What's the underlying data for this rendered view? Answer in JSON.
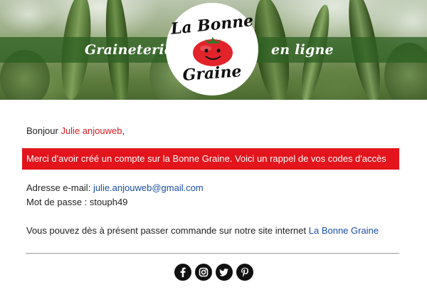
{
  "banner": {
    "left_text": "Graineterie",
    "right_text": "en ligne",
    "logo_top": "La Bonne",
    "logo_bottom": "Graine",
    "band_color": "#2e6022"
  },
  "message": {
    "greeting_prefix": "Bonjour",
    "user_name": "Julie anjouweb",
    "greeting_suffix": ",",
    "alert_text": "Merci d'avoir créé un compte sur la Bonne Graine. Voici un rappel de vos codes d'accès",
    "email_label": "Adresse e-mail:",
    "email_value": "julie.anjouweb@gmail.com",
    "password_label": "Mot de passe :",
    "password_value": "stouph49",
    "order_text": "Vous pouvez dès à présent passer commande sur notre site internet",
    "site_link": "La Bonne Graine"
  },
  "colors": {
    "accent_red": "#e3141c",
    "link_blue": "#1a4fa8"
  },
  "social": [
    {
      "icon": "facebook-icon"
    },
    {
      "icon": "instagram-icon"
    },
    {
      "icon": "twitter-icon"
    },
    {
      "icon": "pinterest-icon"
    }
  ]
}
